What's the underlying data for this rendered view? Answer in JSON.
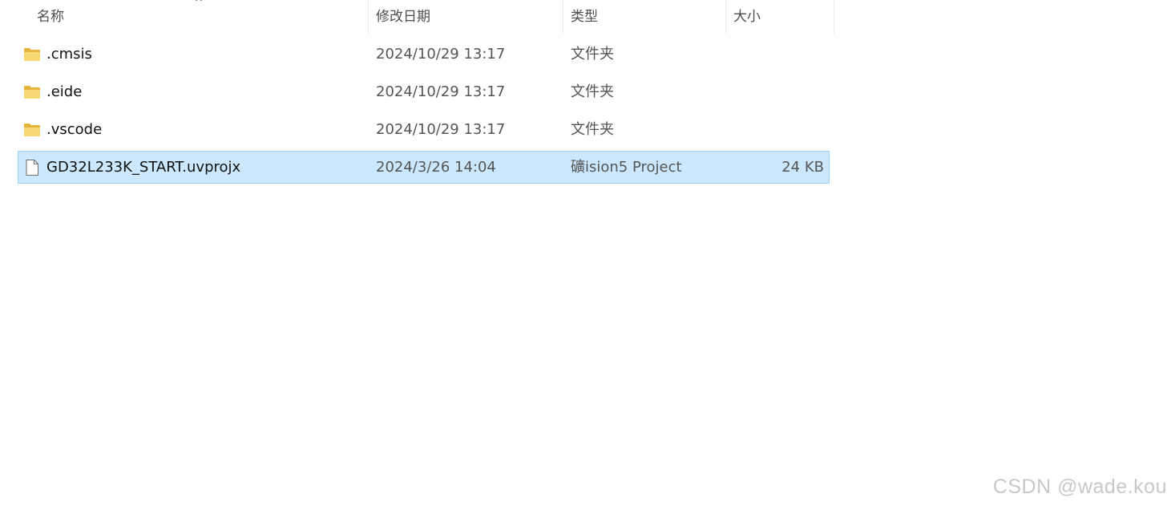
{
  "columns": {
    "name": "名称",
    "date": "修改日期",
    "type": "类型",
    "size": "大小"
  },
  "sort": {
    "column": "name",
    "icon": "sort-ascending-caret-icon",
    "glyph": "^"
  },
  "files": [
    {
      "name": ".cmsis",
      "date": "2024/10/29 13:17",
      "type": "文件夹",
      "size": "",
      "icon": "folder-icon",
      "selected": false
    },
    {
      "name": ".eide",
      "date": "2024/10/29 13:17",
      "type": "文件夹",
      "size": "",
      "icon": "folder-icon",
      "selected": false
    },
    {
      "name": ".vscode",
      "date": "2024/10/29 13:17",
      "type": "文件夹",
      "size": "",
      "icon": "folder-icon",
      "selected": false
    },
    {
      "name": "GD32L233K_START.uvprojx",
      "date": "2024/3/26 14:04",
      "type": "礦ision5 Project",
      "size": "24 KB",
      "icon": "file-icon",
      "selected": true
    }
  ],
  "colors": {
    "selection_bg": "#cce8ff",
    "selection_border": "#99d1ff",
    "folder_yellow": "#f8d775"
  },
  "watermark": "CSDN @wade.kou"
}
